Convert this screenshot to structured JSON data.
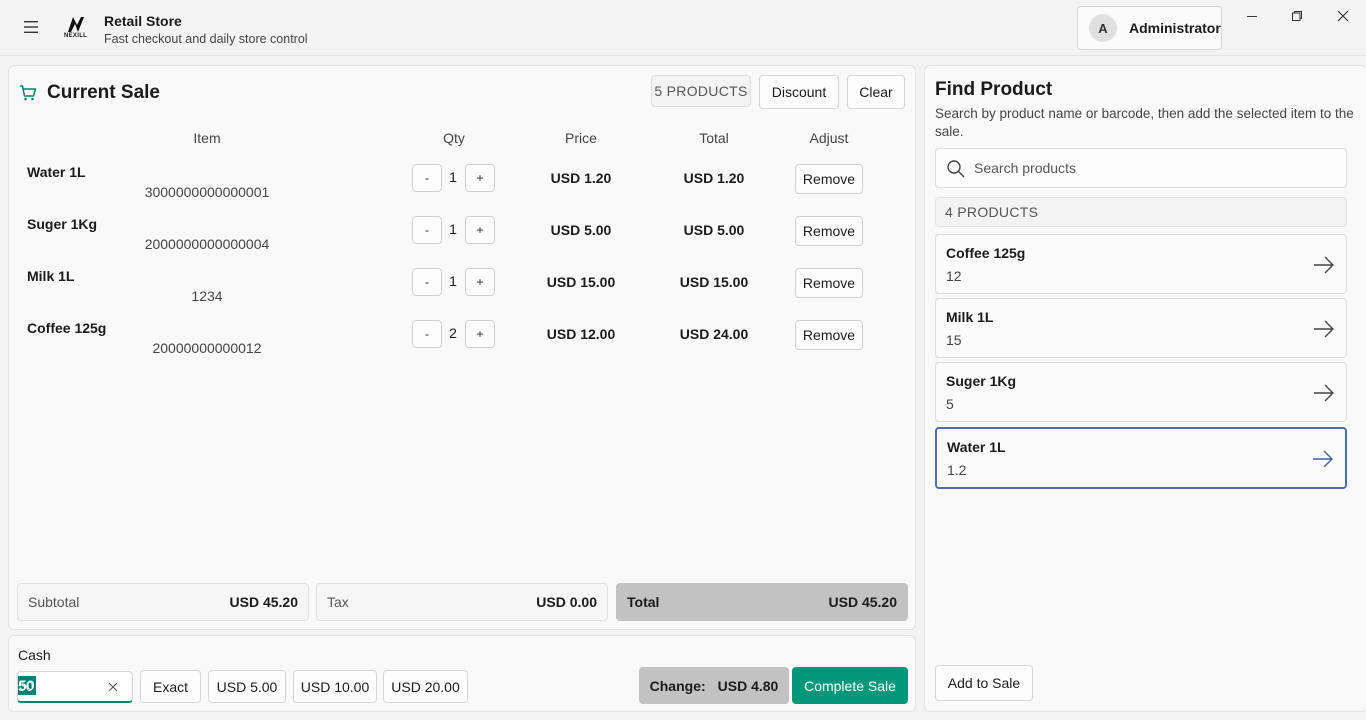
{
  "app": {
    "title": "Retail Store",
    "subtitle": "Fast checkout and daily store control",
    "logo_text": "NEXILL",
    "user_initial": "A",
    "user_name": "Administrator"
  },
  "sale": {
    "title": "Current Sale",
    "products_badge": "5 PRODUCTS",
    "discount_label": "Discount",
    "clear_label": "Clear",
    "columns": {
      "item": "Item",
      "qty": "Qty",
      "price": "Price",
      "total": "Total",
      "adjust": "Adjust"
    },
    "items": [
      {
        "name": "Water 1L",
        "code": "3000000000000001",
        "qty": "1",
        "price": "USD 1.20",
        "total": "USD 1.20",
        "remove": "Remove",
        "minus": "-",
        "plus": "+"
      },
      {
        "name": "Suger 1Kg",
        "code": "2000000000000004",
        "qty": "1",
        "price": "USD 5.00",
        "total": "USD 5.00",
        "remove": "Remove",
        "minus": "-",
        "plus": "+"
      },
      {
        "name": "Milk 1L",
        "code": "1234",
        "qty": "1",
        "price": "USD 15.00",
        "total": "USD 15.00",
        "remove": "Remove",
        "minus": "-",
        "plus": "+"
      },
      {
        "name": "Coffee 125g",
        "code": "20000000000012",
        "qty": "2",
        "price": "USD 12.00",
        "total": "USD 24.00",
        "remove": "Remove",
        "minus": "-",
        "plus": "+"
      }
    ],
    "subtotal_label": "Subtotal",
    "subtotal_value": "USD 45.20",
    "tax_label": "Tax",
    "tax_value": "USD 0.00",
    "total_label": "Total",
    "total_value": "USD 45.20"
  },
  "cash": {
    "label": "Cash",
    "value": "50",
    "exact_label": "Exact",
    "quick": [
      "USD 5.00",
      "USD 10.00",
      "USD 20.00"
    ],
    "change_label": "Change:",
    "change_value": "USD 4.80",
    "complete_label": "Complete Sale"
  },
  "find": {
    "title": "Find Product",
    "description": "Search by product name or barcode, then add the selected item to the sale.",
    "search_placeholder": "Search products",
    "count": "4 PRODUCTS",
    "products": [
      {
        "name": "Coffee 125g",
        "price": "12"
      },
      {
        "name": "Milk 1L",
        "price": "15"
      },
      {
        "name": "Suger 1Kg",
        "price": "5"
      },
      {
        "name": "Water 1L",
        "price": "1.2"
      }
    ],
    "add_label": "Add to Sale"
  },
  "colors": {
    "accent": "#00977a",
    "selected_border": "#4a6fb0",
    "total_bg": "#c2c2c2"
  }
}
